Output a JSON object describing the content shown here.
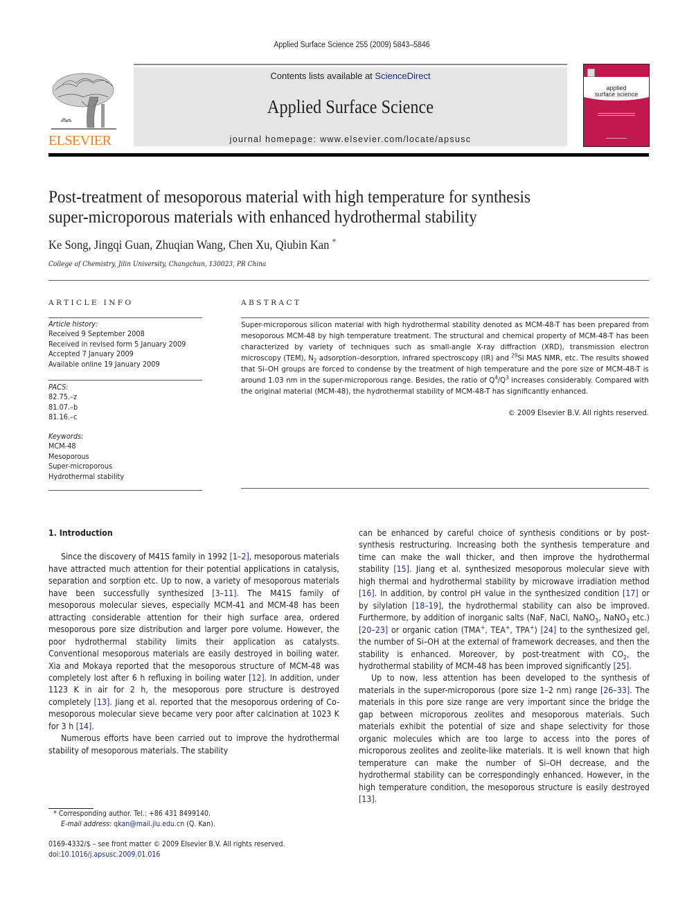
{
  "running_head": "Applied Surface Science 255 (2009) 5843–5846",
  "masthead": {
    "contents_prefix": "Contents lists available at ",
    "contents_link": "ScienceDirect",
    "journal_name": "Applied Surface Science",
    "homepage": "journal homepage: www.elsevier.com/locate/apsusc",
    "publisher_wordmark": "ELSEVIER",
    "cover_title_line1": "applied",
    "cover_title_line2": "surface science",
    "colors": {
      "publisher_orange": "#f07d1a",
      "cover_crimson": "#c2184f",
      "link_blue": "#1a2a8c",
      "masthead_gray": "#e6e6e6"
    }
  },
  "article": {
    "title_line1": "Post-treatment of mesoporous material with high temperature for synthesis",
    "title_line2": "super-microporous materials with enhanced hydrothermal stability",
    "authors": "Ke Song, Jingqi Guan, Zhuqian Wang, Chen Xu, Qiubin Kan",
    "corresponding_mark": "*",
    "affiliation": "College of Chemistry, Jilin University, Changchun, 130023, PR China"
  },
  "article_info": {
    "heading": "ARTICLE INFO",
    "history_label": "Article history:",
    "history": [
      "Received 9 September 2008",
      "Received in revised form 5 January 2009",
      "Accepted 7 January 2009",
      "Available online 19 January 2009"
    ],
    "pacs_label": "PACS:",
    "pacs": [
      "82.75.–z",
      "81.07.–b",
      "81.16.–c"
    ],
    "keywords_label": "Keywords:",
    "keywords": [
      "MCM-48",
      "Mesoporous",
      "Super-microporous",
      "Hydrothermal stability"
    ]
  },
  "abstract": {
    "heading": "ABSTRACT",
    "p1": "Super-microporous silicon material with high hydrothermal stability denoted as MCM-48-T has been prepared from mesoporous MCM-48 by high temperature treatment. The structural and chemical property of MCM-48-T has been characterized by variety of techniques such as small-angle X-ray diffraction (XRD), transmission electron microscopy (TEM), N",
    "sub_2": "2",
    "p2": " adsorption–desorption, infrared spectroscopy (IR) and ",
    "sup_29": "29",
    "p3": "Si MAS NMR, etc. The results showed that Si–OH groups are forced to condense by the treatment of high temperature and the pore size of MCM-48-T is around 1.03 nm in the super-microporous range. Besides, the ratio of Q",
    "sup_4": "4",
    "p4": "/Q",
    "sup_3": "3",
    "p5": " increases considerably. Compared with the original material (MCM-48), the hydrothermal stability of MCM-48-T has significantly enhanced.",
    "copyright": "© 2009 Elsevier B.V. All rights reserved."
  },
  "body": {
    "intro_heading": "1.  Introduction",
    "left": {
      "para1_a": "Since the discovery of M41S family in 1992 ",
      "ref_1_2": "[1–2]",
      "para1_b": ", mesoporous materials have attracted much attention for their potential applications in catalysis, separation and sorption etc. Up to now, a variety of mesoporous materials have been successfully synthesized ",
      "ref_3_11": "[3–11]",
      "para1_c": ". The M41S family of mesoporous molecular sieves, especially MCM-41 and MCM-48 has been attracting considerable attention for their high surface area, ordered mesoporous pore size distribution and larger pore volume. However, the poor hydrothermal stability limits their application as catalysts. Conventional mesoporous materials are easily destroyed in boiling water. Xia and Mokaya reported that the mesoporous structure of MCM-48 was completely lost after 6 h refluxing in boiling water ",
      "ref_12": "[12]",
      "para1_d": ". In addition, under 1123 K in air for 2 h, the mesoporous pore structure is destroyed completely ",
      "ref_13": "[13]",
      "para1_e": ". Jiang et al. reported that the mesoporous ordering of Co-mesoporous molecular sieve became very poor after calcination at 1023 K for 3 h ",
      "ref_14": "[14]",
      "para1_f": ".",
      "para2": "Numerous efforts have been carried out to improve the hydrothermal stability of mesoporous materials. The stability"
    },
    "right": {
      "a": "can be enhanced by careful choice of synthesis conditions or by post-synthesis restructuring. Increasing both the synthesis temperature and time can make the wall thicker, and then improve the hydrothermal stability ",
      "ref_15": "[15]",
      "b": ". Jiang et al. synthesized mesoporous molecular sieve with high thermal and hydrothermal stability by microwave irradiation method ",
      "ref_16": "[16]",
      "c": ". In addition, by control pH value in the synthesized condition ",
      "ref_17": "[17]",
      "d": " or by silylation ",
      "ref_18_19": "[18–19]",
      "e": ", the hydrothermal stability can also be improved. Furthermore, by addition of inorganic salts (NaF, NaCl, NaNO",
      "sub_3a": "3",
      "f": ", NaNO",
      "sub_3b": "3",
      "g": " etc.) ",
      "ref_20_23": "[20–23]",
      "h": " or organic cation (TMA",
      "sup_plus1": "+",
      "i": ", TEA",
      "sup_plus2": "+",
      "j": ", TPA",
      "sup_plus3": "+",
      "k": ") ",
      "ref_24": "[24]",
      "l": " to the synthesized gel, the number of Si–OH at the external of framework decreases, and then the stability is enhanced. Moreover, by post-treatment with CO",
      "sub_2": "2",
      "m": ", the hydrothermal stability of MCM-48 has been improved significantly ",
      "ref_25": "[25]",
      "n": ".",
      "para2_a": "Up to now, less attention has been developed to the synthesis of materials in the super-microporous (pore size 1–2 nm) range ",
      "ref_26_33": "[26–33]",
      "para2_b": ". The materials in this pore size range are very important since the bridge the gap between microporous zeolites and mesoporous materials. Such materials exhibit the potential of size and shape selectivity for those organic molecules which are too large to access into the pores of microporous zeolites and zeolite-like materials. It is well known that high temperature can make the number of Si–OH decrease, and the hydrothermal stability can be correspondingly enhanced. However, in the high temperature condition, the mesoporous structure is easily destroyed ",
      "ref_13": "[13]",
      "para2_c": "."
    }
  },
  "footnotes": {
    "mark": "*",
    "corresponding": "Corresponding author. Tel.: +86 431 8499140.",
    "email_label": "E-mail address:",
    "email": "qkan@mail.jlu.edu.cn",
    "email_suffix": " (Q. Kan).",
    "front_matter": "0169-4332/$ – see front matter © 2009 Elsevier B.V. All rights reserved.",
    "doi_prefix": "doi:",
    "doi": "10.1016/j.apsusc.2009.01.016"
  }
}
